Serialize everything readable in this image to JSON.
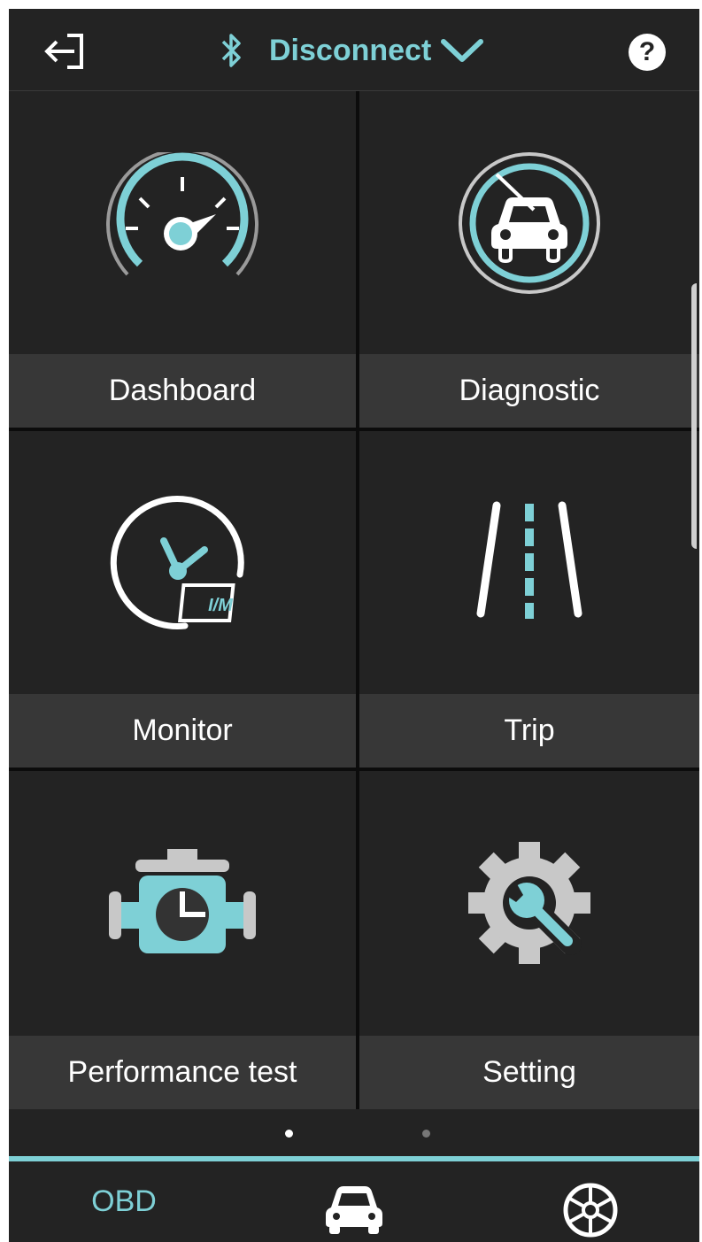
{
  "header": {
    "back_icon": "logout-arrow-icon",
    "bluetooth_icon": "bluetooth-icon",
    "connection_label": "Disconnect",
    "dropdown_icon": "chevron-down-icon",
    "help_label": "?"
  },
  "tiles": [
    {
      "label": "Dashboard",
      "icon": "speedometer-icon"
    },
    {
      "label": "Diagnostic",
      "icon": "car-diagnostic-icon"
    },
    {
      "label": "Monitor",
      "icon": "im-monitor-icon"
    },
    {
      "label": "Trip",
      "icon": "road-icon"
    },
    {
      "label": "Performance test",
      "icon": "engine-icon"
    },
    {
      "label": "Setting",
      "icon": "gear-wrench-icon"
    }
  ],
  "pager": {
    "pages": 2,
    "active_page": 1
  },
  "monitor_badge": "I/M",
  "bottom_nav": {
    "obd_label": "OBD",
    "car_icon": "car-icon",
    "wheel_icon": "steering-wheel-icon"
  },
  "colors": {
    "accent": "#7ed0d6",
    "background": "#232323",
    "label_bar": "#373737",
    "icon_gray": "#c8c8c8"
  }
}
